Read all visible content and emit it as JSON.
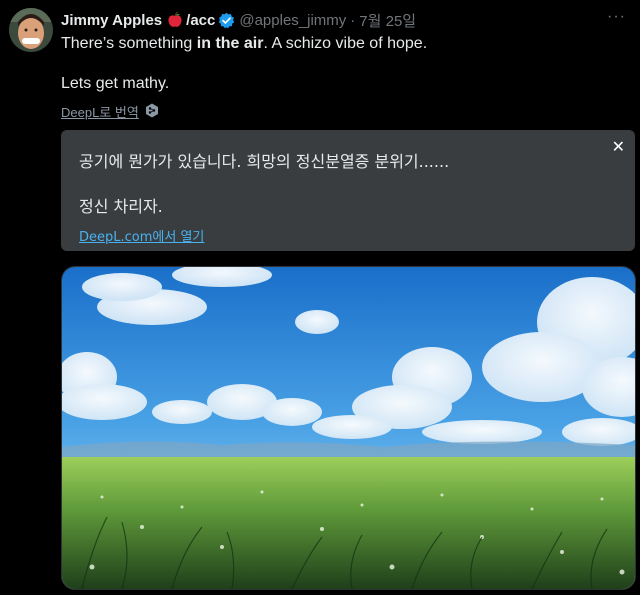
{
  "author": {
    "display_name": "Jimmy Apples",
    "suffix": "/acc",
    "handle": "@apples_jimmy",
    "separator": "·",
    "date": "7월 25일"
  },
  "tweet": {
    "line1_pre": "There’s something ",
    "line1_bold": "in the air",
    "line1_post": ". A schizo vibe of hope.",
    "line2": "Lets get mathy."
  },
  "translate": {
    "link_label": "DeepL로 번역",
    "line1": "공기에 뭔가가 있습니다. 희망의 정신분열증 분위기......",
    "line2": "정신 차리자.",
    "open_label": "DeepL.com에서 열기",
    "close_glyph": "✕"
  },
  "more_glyph": "···",
  "colors": {
    "background": "#000000",
    "text": "#e7e9ea",
    "muted": "#71767b",
    "verified": "#1d9bf0",
    "link": "#48b2f0",
    "translation_bg": "#3a3d40"
  },
  "icons": [
    "apple-icon",
    "verified-badge-icon",
    "deepl-icon",
    "close-icon",
    "more-icon"
  ]
}
